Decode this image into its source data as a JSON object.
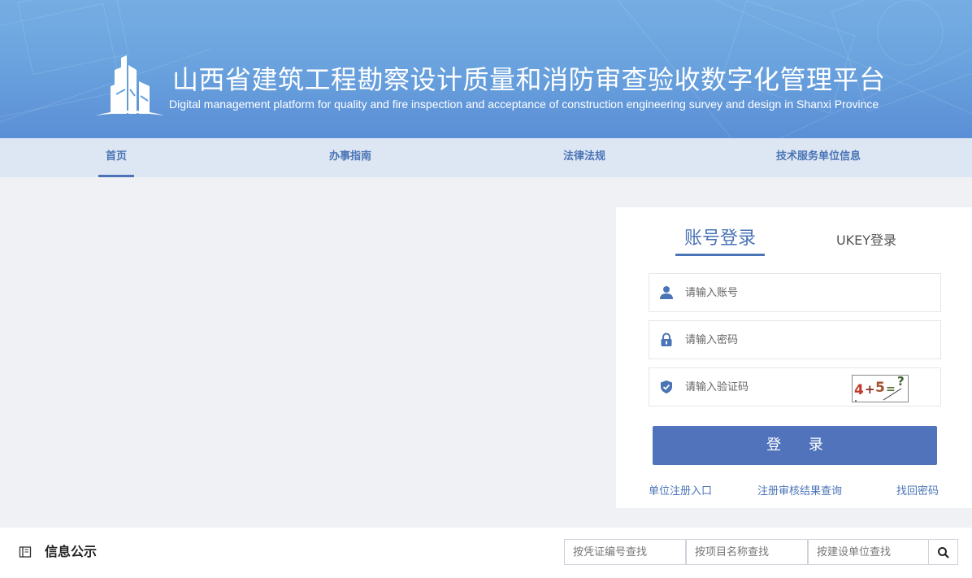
{
  "header": {
    "title_cn": "山西省建筑工程勘察设计质量和消防审查验收数字化管理平台",
    "title_en": "Digital management platform for quality and fire inspection and acceptance of construction engineering survey and design in Shanxi Province",
    "logo_icon": "building-logo-icon"
  },
  "nav": {
    "items": [
      {
        "label": "首页",
        "active": true
      },
      {
        "label": "办事指南",
        "active": false
      },
      {
        "label": "法律法规",
        "active": false
      },
      {
        "label": "技术服务单位信息",
        "active": false
      }
    ]
  },
  "login": {
    "tabs": [
      {
        "label": "账号登录",
        "active": true
      },
      {
        "label": "UKEY登录",
        "active": false
      }
    ],
    "account_placeholder": "请输入账号",
    "password_placeholder": "请输入密码",
    "captcha_placeholder": "请输入验证码",
    "captcha": {
      "c1": "4",
      "c2": "+",
      "c3": "5",
      "c4": "=",
      "c5": "?"
    },
    "submit_label": "登 录",
    "links": {
      "register": "单位注册入口",
      "query": "注册审核结果查询",
      "recover": "找回密码"
    }
  },
  "info": {
    "title": "信息公示",
    "search": {
      "cert_placeholder": "按凭证编号查找",
      "project_placeholder": "按项目名称查找",
      "unit_placeholder": "按建设单位查找"
    }
  },
  "colors": {
    "accent": "#4a74b6",
    "button": "#5073bb",
    "nav_bg": "#dde6f3",
    "page_bg": "#f0f1f5"
  }
}
